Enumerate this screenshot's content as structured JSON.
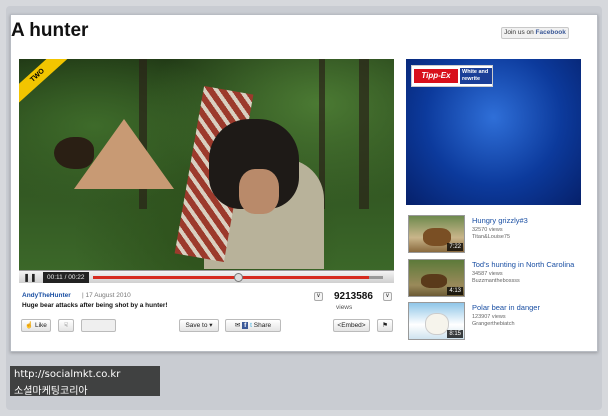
{
  "page": {
    "title": "A hunter",
    "facebook_button": {
      "prefix": "Join us on ",
      "brand": "Facebook"
    }
  },
  "video": {
    "badge": "TWO",
    "current_time": "00:11",
    "duration": "00:22",
    "time_separator": " / ",
    "progress_fraction": 0.5,
    "buffered_fraction": 0.95
  },
  "info": {
    "uploader": "AndyTheHunter",
    "date_separator": "|",
    "upload_date": "17 August 2010",
    "description": "Huge bear attacks after being shot by a hunter!",
    "view_count": "9213586",
    "views_label": "views"
  },
  "actions": {
    "like_label": "Like",
    "save_to_label": "Save to",
    "share_label": "Share",
    "embed_label": "<Embed>"
  },
  "ad": {
    "brand": "Tipp-Ex",
    "tagline": "White and rewrite"
  },
  "related": [
    {
      "title": "Hungry grizzly#3",
      "views": "32570 views",
      "author": "Titan&Louise75",
      "duration": "7:22"
    },
    {
      "title": "Tod's hunting in North Carolina",
      "views": "34587 views",
      "author": "Buzzmanthebossss",
      "duration": "4:13"
    },
    {
      "title": "Polar bear in danger",
      "views": "123907 views",
      "author": "Grangerthebiatch",
      "duration": "8:15"
    }
  ],
  "watermark": {
    "line1": "http://socialmkt.co.kr",
    "line2": "소셜마케팅코리아"
  },
  "colors": {
    "link": "#1a4fa3",
    "progress": "#d62b1f",
    "ad_brand": "#d8101b"
  }
}
